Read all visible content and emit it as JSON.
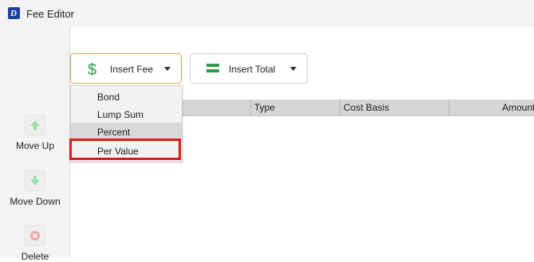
{
  "window": {
    "title": "Fee Editor"
  },
  "toolbar": {
    "insert_fee_label": "Insert Fee",
    "insert_total_label": "Insert Total"
  },
  "dropdown": {
    "items": [
      {
        "label": "Bond"
      },
      {
        "label": "Lump Sum"
      },
      {
        "label": "Percent",
        "hovered": true
      },
      {
        "label": "Per Value",
        "highlighted": true
      }
    ]
  },
  "grid": {
    "columns": [
      "Type",
      "Cost Basis",
      "Amount"
    ]
  },
  "left_rail": {
    "move_up_label": "Move Up",
    "move_down_label": "Move Down",
    "delete_label": "Delete"
  },
  "colors": {
    "accent_border": "#e6a640",
    "highlight_red": "#e0191c",
    "icon_green": "#2f9a4a"
  }
}
